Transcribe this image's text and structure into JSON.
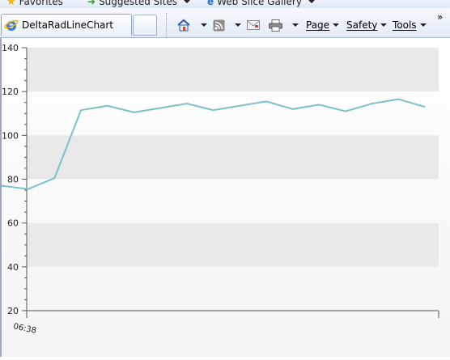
{
  "favorites_bar": {
    "favorites_label": "Favorites",
    "suggested_sites_label": "Suggested Sites",
    "web_slice_gallery_label": "Web Slice Gallery"
  },
  "tab": {
    "title": "DeltaRadLineChart"
  },
  "command_bar": {
    "page_label": "Page",
    "safety_label": "Safety",
    "tools_label": "Tools",
    "overflow_label": "»"
  },
  "colors": {
    "line": "#7bbfcf",
    "band": "#e9e9e9"
  },
  "chart_data": {
    "type": "line",
    "y_ticks": [
      20,
      40,
      60,
      80,
      100,
      120,
      140
    ],
    "ylim": [
      20,
      140
    ],
    "x_tick_labels": [
      "06:38"
    ],
    "grid": "alternating horizontal bands",
    "series": [
      {
        "values": [
          77,
          75.5,
          80.5,
          111.5,
          113.5,
          110.5,
          112.5,
          114.5,
          111.5,
          113.5,
          115.5,
          112,
          114,
          111,
          114.5,
          116.5,
          113
        ]
      }
    ]
  }
}
